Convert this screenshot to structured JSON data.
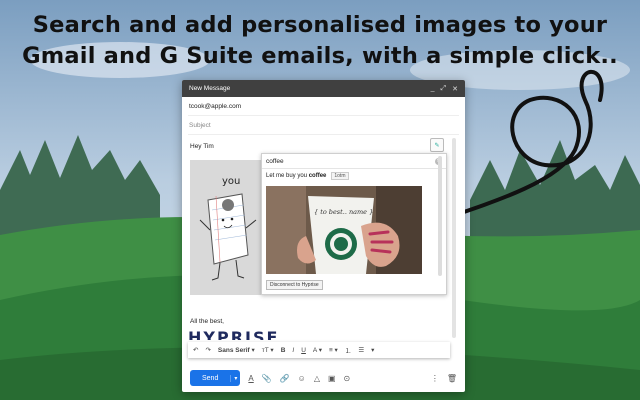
{
  "headline": {
    "line1": "Search and add personalised images to your",
    "line2": "Gmail and G Suite emails, with a simple click.."
  },
  "compose": {
    "title": "New Message",
    "to": "tcook@apple.com",
    "subject_placeholder": "Subject",
    "greeting": "Hey Tim",
    "closing": "All the best,",
    "logo_text": "HYPRISE",
    "send_label": "Send",
    "font_name": "Sans Serif"
  },
  "hyprise_panel": {
    "search_value": "coffee",
    "caption_prefix": "Let me buy you",
    "caption_keyword": "coffee",
    "tag": "1otm",
    "photo_note": "{ to best.. name }",
    "disconnect_label": "Disconnect to Hyprise"
  },
  "cartoon": {
    "speech": "you"
  },
  "colors": {
    "sky_top": "#7fa3c4",
    "send_blue": "#1a73e8",
    "titlebar": "#404040"
  }
}
